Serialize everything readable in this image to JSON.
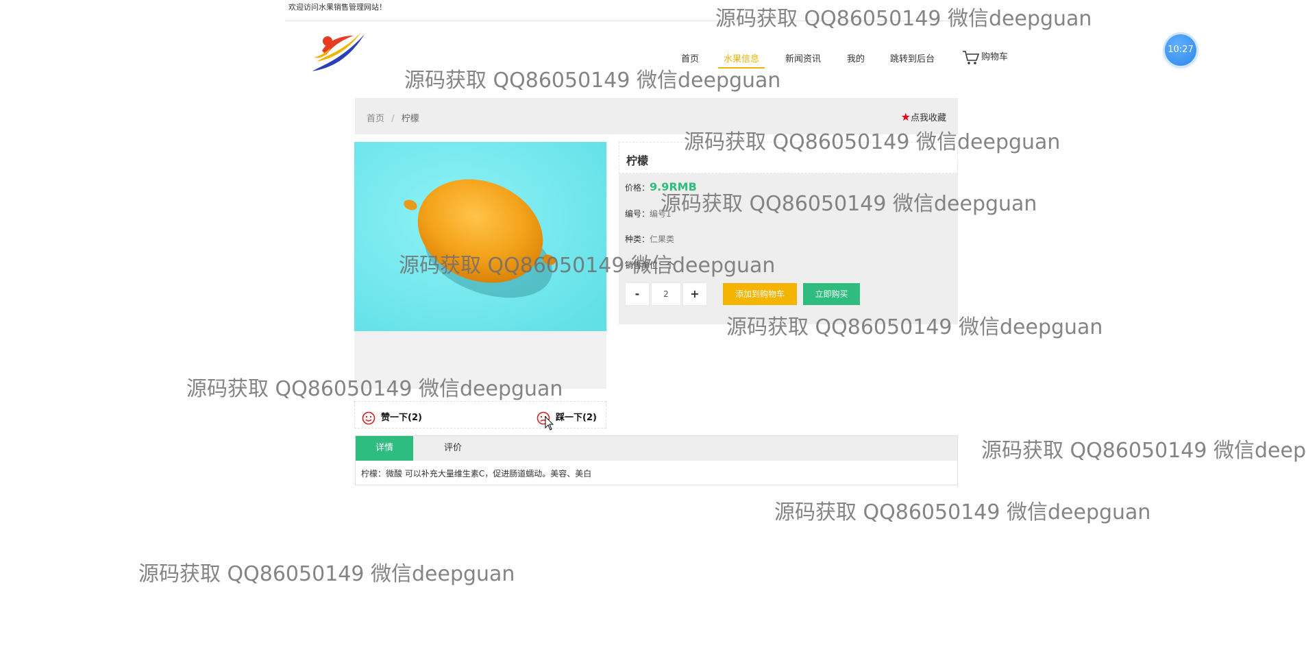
{
  "topbar": {
    "welcome": "欢迎访问水果销售管理网站！"
  },
  "header": {
    "logo_icon": "company-logo-icon",
    "nav": [
      {
        "label": "首页",
        "active": false
      },
      {
        "label": "水果信息",
        "active": true
      },
      {
        "label": "新闻资讯",
        "active": false
      },
      {
        "label": "我的",
        "active": false
      },
      {
        "label": "跳转到后台",
        "active": false
      }
    ],
    "cart_label": "购物车",
    "cart_icon": "shopping-cart-icon"
  },
  "clock": {
    "time": "10:27"
  },
  "breadcrumb": {
    "home": "首页",
    "separator": "/",
    "current": "柠檬"
  },
  "favorite": {
    "label": "点我收藏",
    "icon": "star-icon",
    "color": "#e60012"
  },
  "product": {
    "name": "柠檬",
    "price_label": "价格：",
    "price": "9.9RMB",
    "code_label": "编号：",
    "code": "编号1",
    "category_label": "种类：",
    "category": "仁果类",
    "unit_label": "销售单位：个",
    "quantity": "2",
    "minus": "-",
    "plus": "+",
    "add_to_cart": "添加到购物车",
    "buy_now": "立即购买",
    "image_icon": "lemon-photo"
  },
  "reactions": {
    "like": "赞一下(2)",
    "dislike": "踩一下(2)",
    "like_icon": "smile-icon",
    "dislike_icon": "frown-icon"
  },
  "tabs": {
    "detail": "详情",
    "review": "评价",
    "description": "柠檬：微酸 可以补充大量维生素C，促进肠道蠕动。美容、美白"
  },
  "watermark": "源码获取 QQ86050149 微信deepguan",
  "colors": {
    "accent_green": "#2ebd7f",
    "accent_yellow": "#f5b400",
    "nav_active": "#f0b400"
  }
}
